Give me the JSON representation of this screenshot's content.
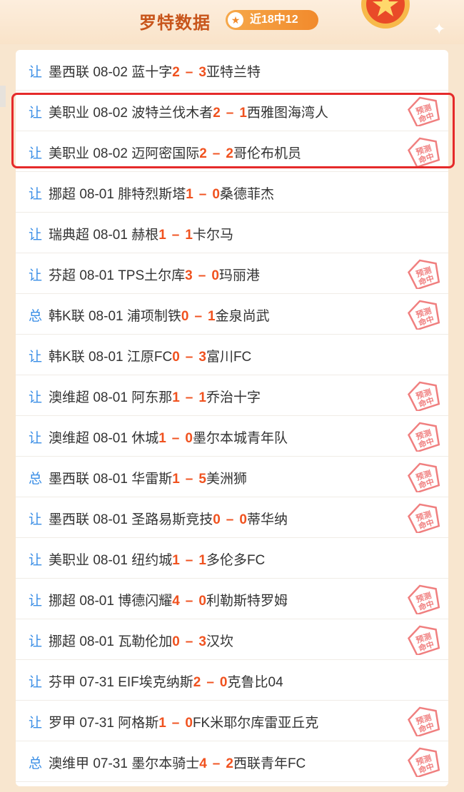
{
  "header": {
    "title": "罗特数据",
    "hit_badge": "近18中12",
    "star_glyph": "★"
  },
  "stamp_text": "预测命中",
  "rows": [
    {
      "kind": "让",
      "league": "墨西联",
      "date": "08-02",
      "home": "蓝十字",
      "hs": "2",
      "as": "3",
      "away": "亚特兰特",
      "hit": false
    },
    {
      "kind": "让",
      "league": "美职业",
      "date": "08-02",
      "home": "波特兰伐木者",
      "hs": "2",
      "as": "1",
      "away": "西雅图海湾人",
      "hit": true
    },
    {
      "kind": "让",
      "league": "美职业",
      "date": "08-02",
      "home": "迈阿密国际",
      "hs": "2",
      "as": "2",
      "away": "哥伦布机员",
      "hit": true
    },
    {
      "kind": "让",
      "league": "挪超",
      "date": "08-01",
      "home": "腓特烈斯塔",
      "hs": "1",
      "as": "0",
      "away": "桑德菲杰",
      "hit": false
    },
    {
      "kind": "让",
      "league": "瑞典超",
      "date": "08-01",
      "home": "赫根",
      "hs": "1",
      "as": "1",
      "away": "卡尔马",
      "hit": false
    },
    {
      "kind": "让",
      "league": "芬超",
      "date": "08-01",
      "home": "TPS土尔库",
      "hs": "3",
      "as": "0",
      "away": "玛丽港",
      "hit": true
    },
    {
      "kind": "总",
      "league": "韩K联",
      "date": "08-01",
      "home": "浦项制铁",
      "hs": "0",
      "as": "1",
      "away": "金泉尚武",
      "hit": true
    },
    {
      "kind": "让",
      "league": "韩K联",
      "date": "08-01",
      "home": "江原FC",
      "hs": "0",
      "as": "3",
      "away": "富川FC",
      "hit": false
    },
    {
      "kind": "让",
      "league": "澳维超",
      "date": "08-01",
      "home": "阿东那",
      "hs": "1",
      "as": "1",
      "away": "乔治十字",
      "hit": true
    },
    {
      "kind": "让",
      "league": "澳维超",
      "date": "08-01",
      "home": "休城",
      "hs": "1",
      "as": "0",
      "away": "墨尔本城青年队",
      "hit": true
    },
    {
      "kind": "总",
      "league": "墨西联",
      "date": "08-01",
      "home": "华雷斯",
      "hs": "1",
      "as": "5",
      "away": "美洲狮",
      "hit": true
    },
    {
      "kind": "让",
      "league": "墨西联",
      "date": "08-01",
      "home": "圣路易斯竞技",
      "hs": "0",
      "as": "0",
      "away": "蒂华纳",
      "hit": true
    },
    {
      "kind": "让",
      "league": "美职业",
      "date": "08-01",
      "home": "纽约城",
      "hs": "1",
      "as": "1",
      "away": "多伦多FC",
      "hit": false
    },
    {
      "kind": "让",
      "league": "挪超",
      "date": "08-01",
      "home": "博德闪耀",
      "hs": "4",
      "as": "0",
      "away": "利勒斯特罗姆",
      "hit": true
    },
    {
      "kind": "让",
      "league": "挪超",
      "date": "08-01",
      "home": "瓦勒伦加",
      "hs": "0",
      "as": "3",
      "away": "汉坎",
      "hit": true
    },
    {
      "kind": "让",
      "league": "芬甲",
      "date": "07-31",
      "home": "EIF埃克纳斯",
      "hs": "2",
      "as": "0",
      "away": "克鲁比04",
      "hit": false
    },
    {
      "kind": "让",
      "league": "罗甲",
      "date": "07-31",
      "home": "阿格斯",
      "hs": "1",
      "as": "0",
      "away": "FK米耶尔库雷亚丘克",
      "hit": true
    },
    {
      "kind": "总",
      "league": "澳维甲",
      "date": "07-31",
      "home": "墨尔本骑士",
      "hs": "4",
      "as": "2",
      "away": "西联青年FC",
      "hit": true
    }
  ],
  "colors": {
    "accent": "#f0521f",
    "kind": "#3a8ee6",
    "highlight": "#e52a2a",
    "title": "#c8551b"
  }
}
